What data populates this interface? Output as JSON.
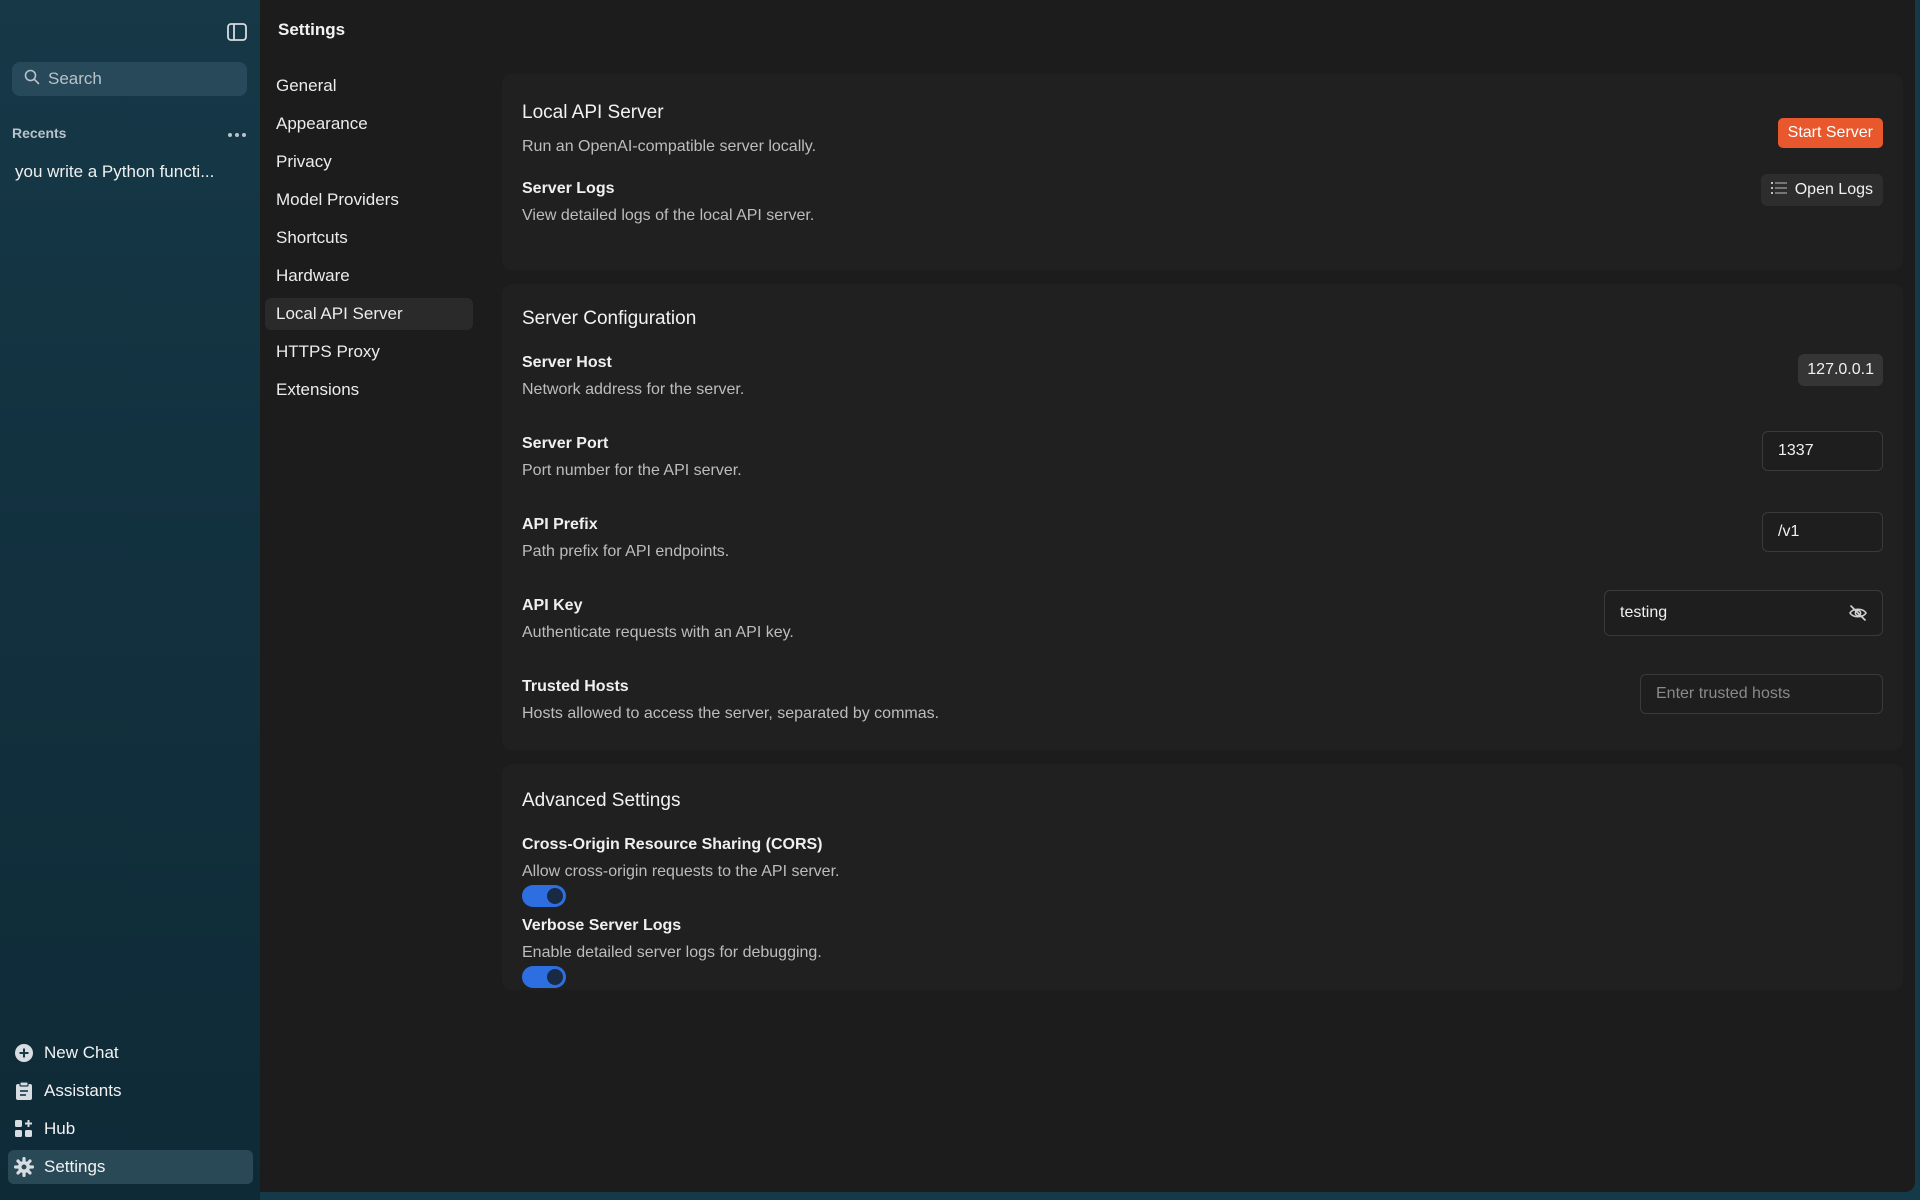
{
  "sidebar": {
    "toggle_icon": "sidebar-toggle-icon",
    "search_placeholder": "Search",
    "recents_label": "Recents",
    "recent_items": [
      "you write a Python functi..."
    ],
    "bottom_nav": [
      {
        "label": "New Chat",
        "icon": "plus-circle-icon"
      },
      {
        "label": "Assistants",
        "icon": "clipboard-icon"
      },
      {
        "label": "Hub",
        "icon": "grid-plus-icon"
      },
      {
        "label": "Settings",
        "icon": "gear-icon",
        "active": true
      }
    ]
  },
  "header": {
    "title": "Settings"
  },
  "settings_nav": [
    {
      "label": "General"
    },
    {
      "label": "Appearance"
    },
    {
      "label": "Privacy"
    },
    {
      "label": "Model Providers"
    },
    {
      "label": "Shortcuts"
    },
    {
      "label": "Hardware"
    },
    {
      "label": "Local API Server",
      "active": true
    },
    {
      "label": "HTTPS Proxy"
    },
    {
      "label": "Extensions"
    }
  ],
  "local_api": {
    "title": "Local API Server",
    "desc": "Run an OpenAI-compatible server locally.",
    "start_button": "Start Server",
    "logs_label": "Server Logs",
    "logs_desc": "View detailed logs of the local API server.",
    "logs_button": "Open Logs"
  },
  "config": {
    "title": "Server Configuration",
    "host": {
      "label": "Server Host",
      "desc": "Network address for the server.",
      "value": "127.0.0.1"
    },
    "port": {
      "label": "Server Port",
      "desc": "Port number for the API server.",
      "value": "1337"
    },
    "prefix": {
      "label": "API Prefix",
      "desc": "Path prefix for API endpoints.",
      "value": "/v1"
    },
    "api_key": {
      "label": "API Key",
      "desc": "Authenticate requests with an API key.",
      "value": "testing"
    },
    "trusted": {
      "label": "Trusted Hosts",
      "desc": "Hosts allowed to access the server, separated by commas.",
      "placeholder": "Enter trusted hosts"
    }
  },
  "advanced": {
    "title": "Advanced Settings",
    "cors": {
      "label": "Cross-Origin Resource Sharing (CORS)",
      "desc": "Allow cross-origin requests to the API server.",
      "enabled": true
    },
    "verbose": {
      "label": "Verbose Server Logs",
      "desc": "Enable detailed server logs for debugging.",
      "enabled": true
    }
  },
  "colors": {
    "accent": "#2d6ee0",
    "start_button": "#e8582c",
    "sidebar_bg": "#143a4a",
    "main_bg": "#1c1c1c"
  }
}
